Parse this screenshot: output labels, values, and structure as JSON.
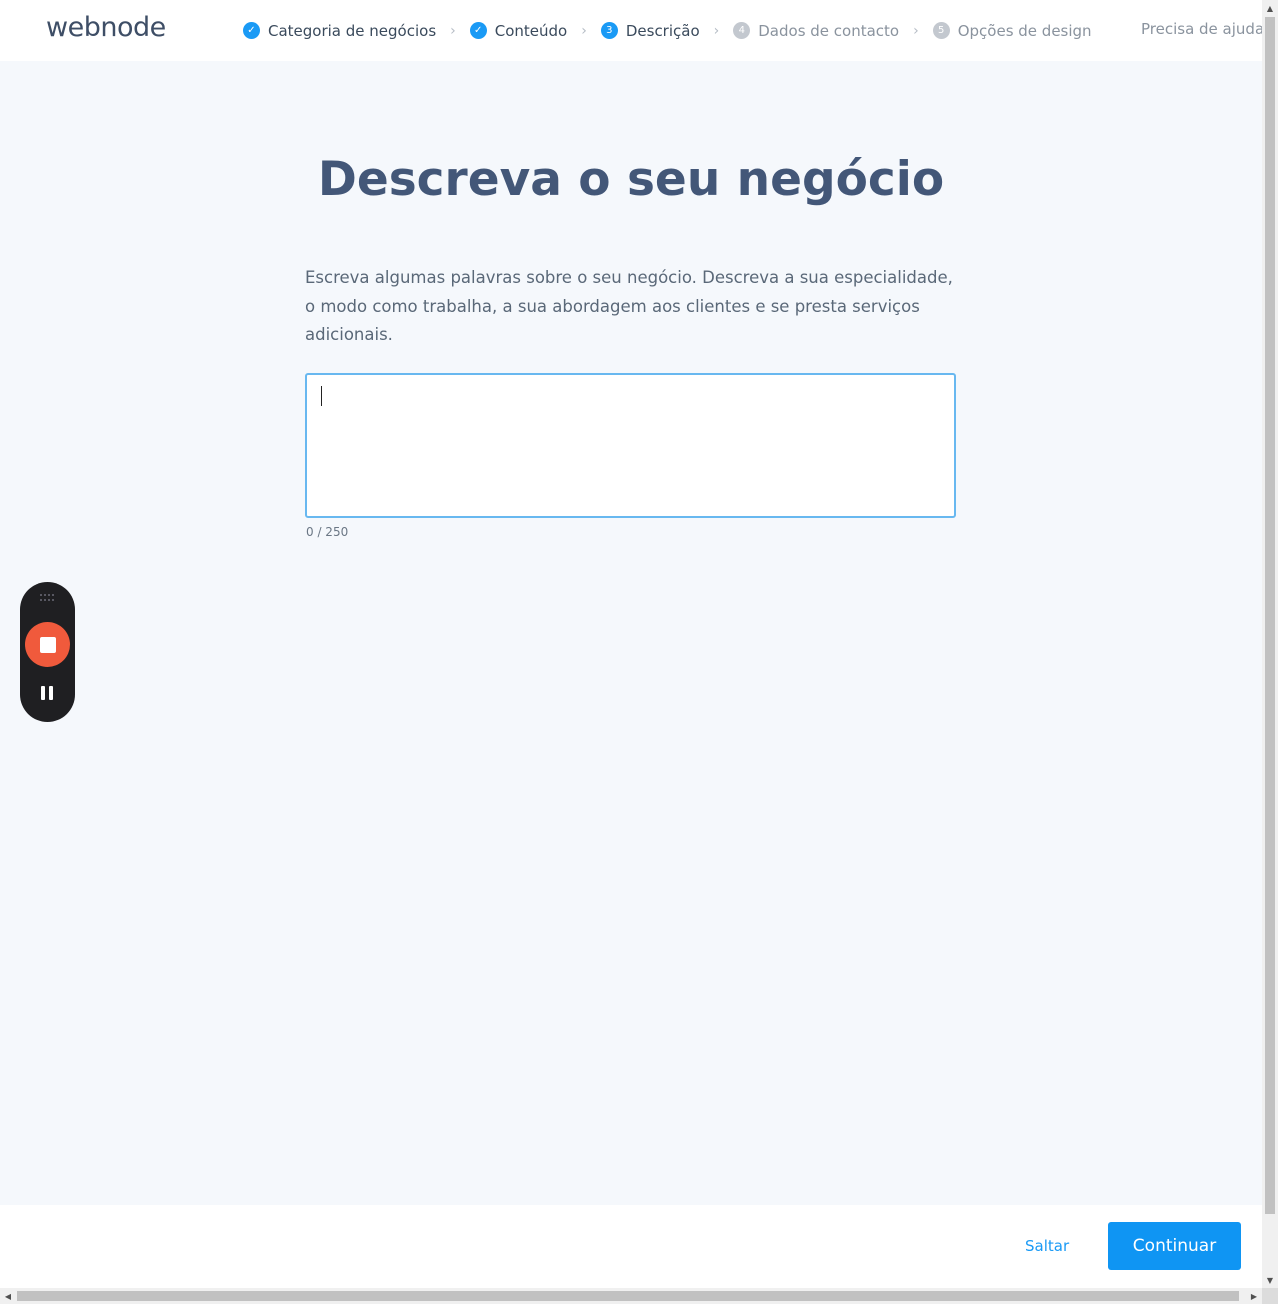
{
  "header": {
    "logo": "webnode",
    "steps": [
      {
        "badge": "✓",
        "label": "Categoria de negócios",
        "state": "done"
      },
      {
        "badge": "✓",
        "label": "Conteúdo",
        "state": "done"
      },
      {
        "badge": "3",
        "label": "Descrição",
        "state": "current"
      },
      {
        "badge": "4",
        "label": "Dados de contacto",
        "state": "todo"
      },
      {
        "badge": "5",
        "label": "Opções de design",
        "state": "todo"
      }
    ],
    "separator": "›",
    "help": "Precisa de ajuda?"
  },
  "main": {
    "title": "Descreva o seu negócio",
    "description": "Escreva algumas palavras sobre o seu negócio. Descreva a sua especialidade, o modo como trabalha, a sua abordagem aos clientes e se presta serviços adicionais.",
    "textarea_value": "",
    "counter": "0 / 250"
  },
  "footer": {
    "skip_label": "Saltar",
    "continue_label": "Continuar"
  },
  "scrollbar": {
    "up": "▲",
    "down": "▼",
    "left": "◀",
    "right": "▶"
  },
  "colors": {
    "accent": "#0f95f3",
    "title": "#435778",
    "recorder_stop": "#f05a3c"
  }
}
